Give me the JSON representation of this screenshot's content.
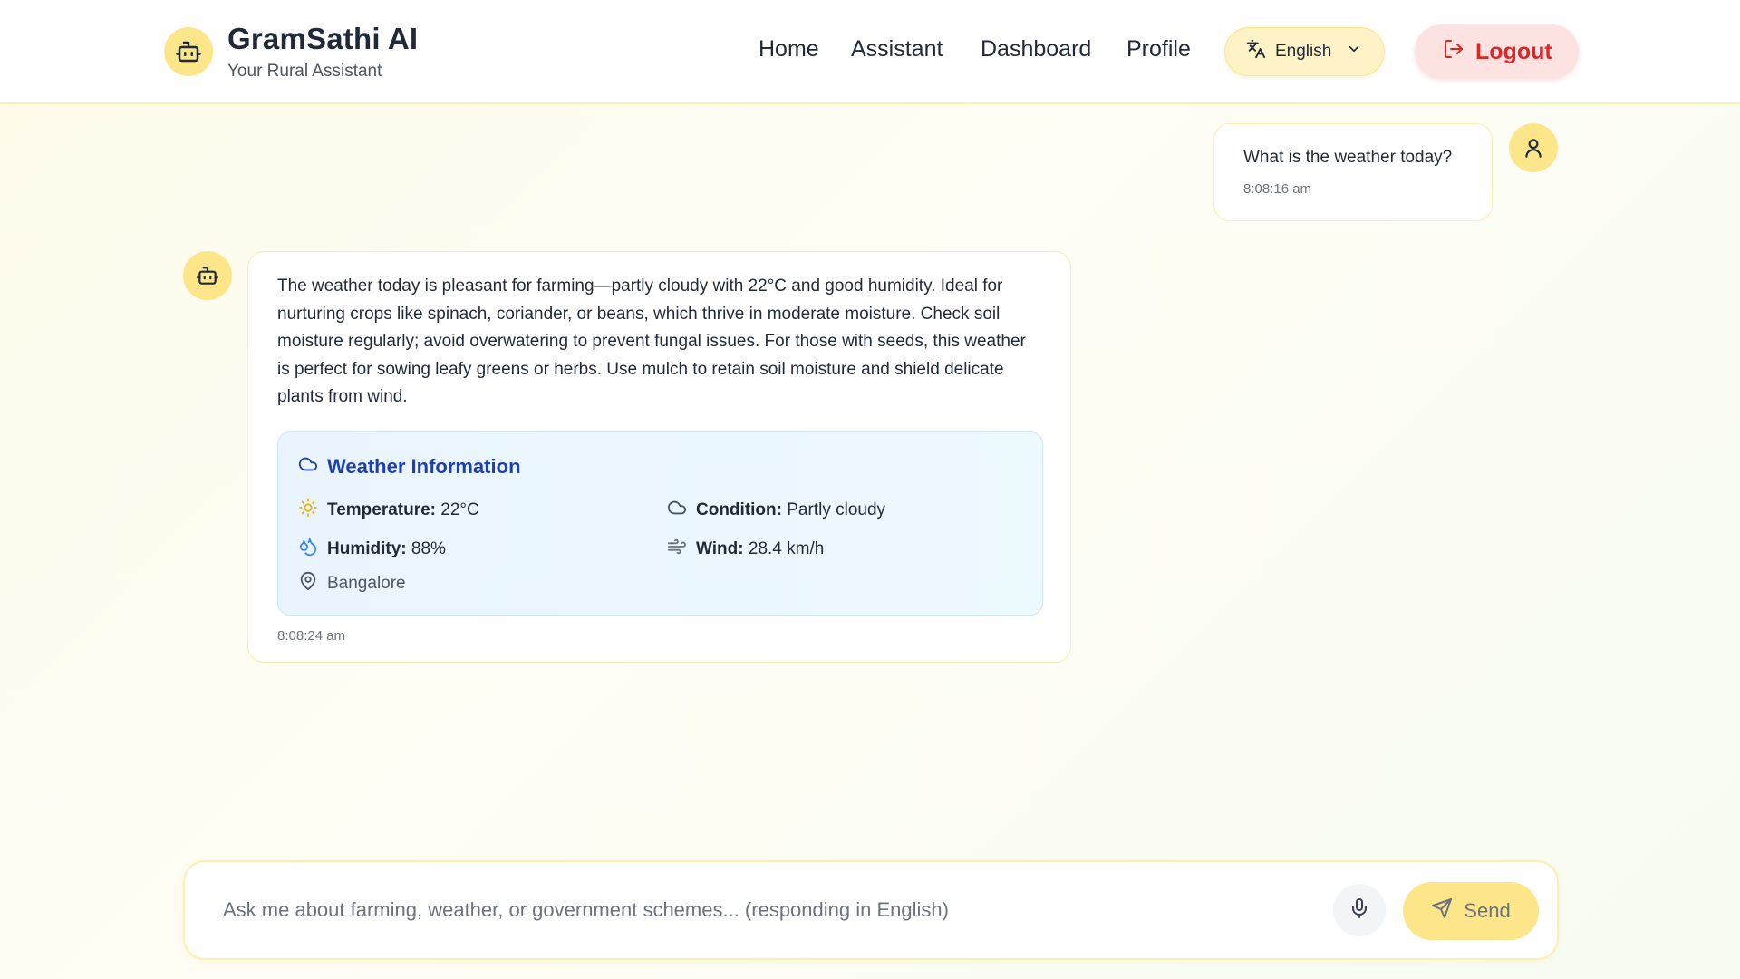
{
  "header": {
    "brand_title": "GramSathi AI",
    "brand_subtitle": "Your Rural Assistant",
    "nav": [
      "Home",
      "Assistant",
      "Dashboard",
      "Profile"
    ],
    "language": "English",
    "logout_label": "Logout"
  },
  "conversation": {
    "user_message": {
      "text": "What is the weather today?",
      "time": "8:08:16 am"
    },
    "bot_message": {
      "text": "The weather today is pleasant for farming—partly cloudy with 22°C and good humidity. Ideal for nurturing crops like spinach, coriander, or beans, which thrive in moderate moisture. Check soil moisture regularly; avoid overwatering to prevent fungal issues. For those with seeds, this weather is perfect for sowing leafy greens or herbs. Use mulch to retain soil moisture and shield delicate plants from wind.",
      "time": "8:08:24 am",
      "weather": {
        "title": "Weather Information",
        "temperature_label": "Temperature:",
        "temperature_value": "22°C",
        "condition_label": "Condition:",
        "condition_value": "Partly cloudy",
        "humidity_label": "Humidity:",
        "humidity_value": "88%",
        "wind_label": "Wind:",
        "wind_value": "28.4 km/h",
        "location": "Bangalore"
      }
    }
  },
  "composer": {
    "placeholder": "Ask me about farming, weather, or government schemes... (responding in English)",
    "send_label": "Send"
  },
  "colors": {
    "accent_yellow": "#fde68a",
    "logout_red": "#dc2626",
    "weather_title_blue": "#1e40af"
  }
}
